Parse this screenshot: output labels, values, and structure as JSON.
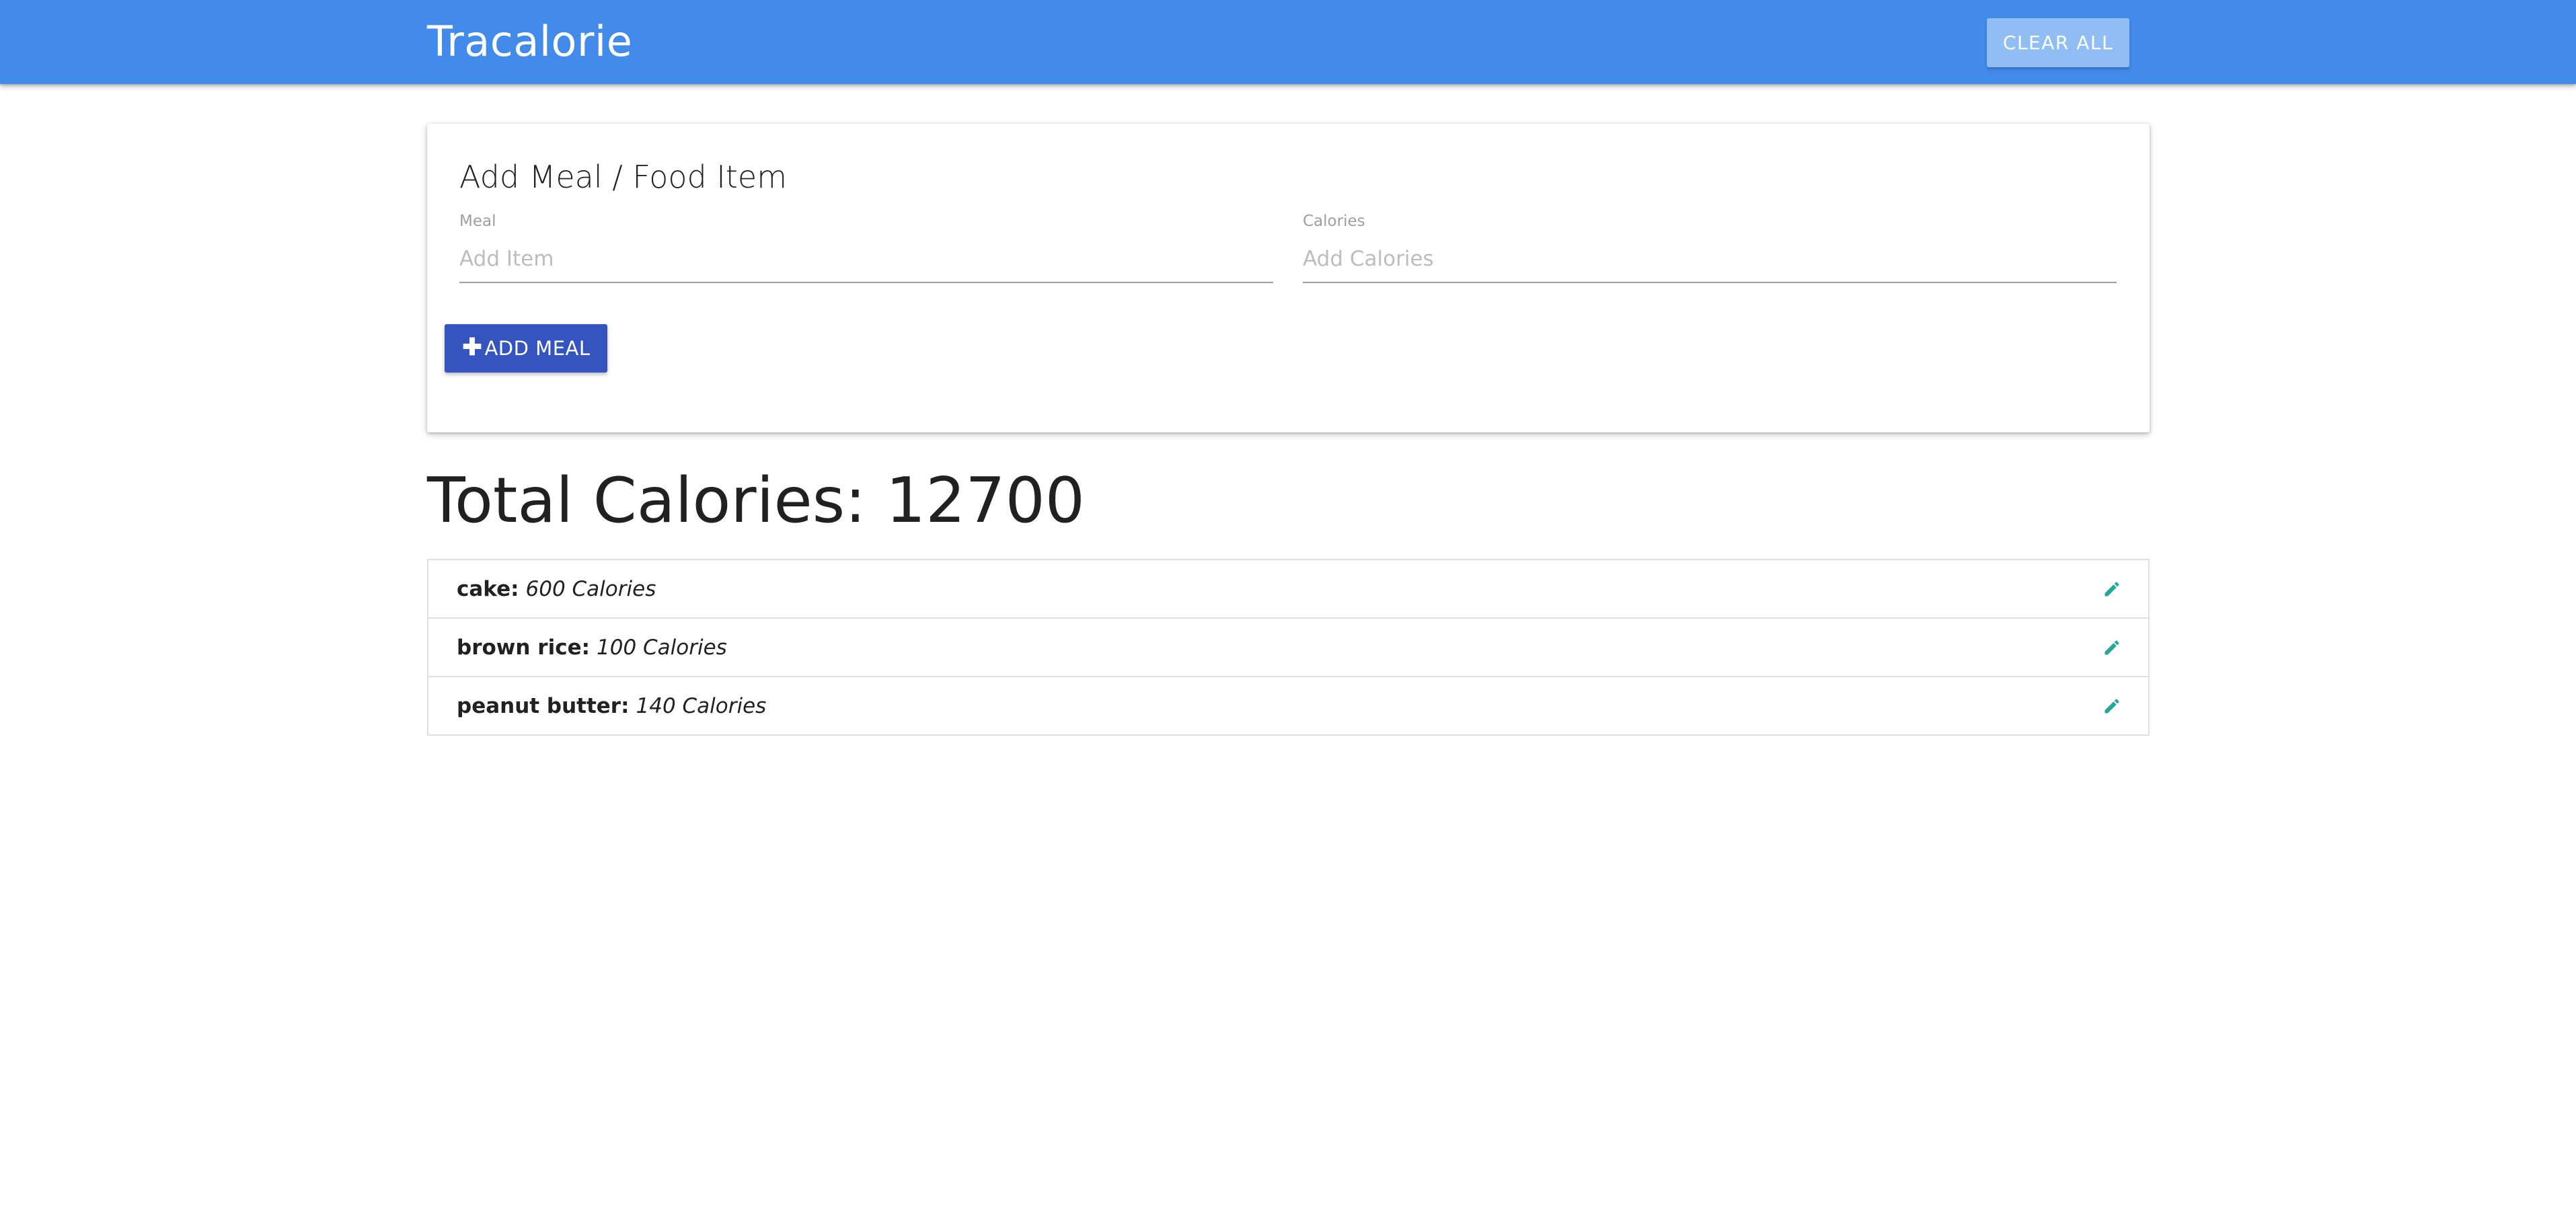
{
  "navbar": {
    "brand": "Tracalorie",
    "clear_all_label": "CLEAR ALL"
  },
  "form": {
    "title": "Add Meal / Food Item",
    "meal_label": "Meal",
    "meal_placeholder": "Add Item",
    "meal_value": "",
    "calories_label": "Calories",
    "calories_placeholder": "Add Calories",
    "calories_value": "",
    "add_button_label": "ADD MEAL",
    "add_button_icon": "plus-icon"
  },
  "total": {
    "label": "Total Calories: 12700"
  },
  "items": [
    {
      "name": "cake:",
      "calories": "600 Calories",
      "icon": "pencil-icon"
    },
    {
      "name": "brown rice:",
      "calories": "100 Calories",
      "icon": "pencil-icon"
    },
    {
      "name": "peanut butter:",
      "calories": "140 Calories",
      "icon": "pencil-icon"
    }
  ],
  "colors": {
    "navbar": "#428bea",
    "clear_button": "#8fbdf4",
    "add_button": "#3454c0",
    "edit_icon": "#26a69a"
  }
}
